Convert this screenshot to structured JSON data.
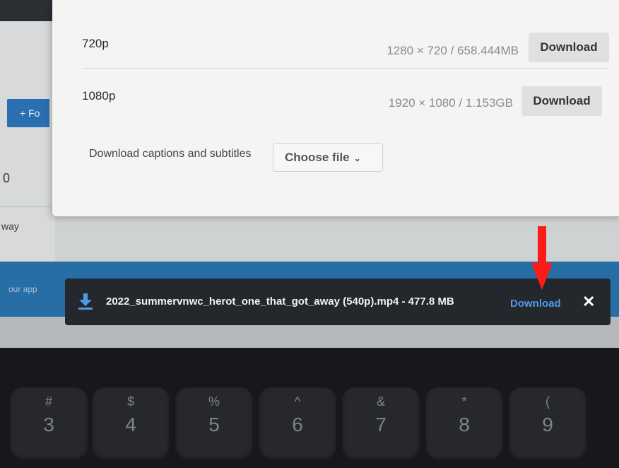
{
  "left_sidebar": {
    "follow_label": "+ Fo",
    "count": "0",
    "away_text": "way",
    "our_app": "our app"
  },
  "modal": {
    "rows": [
      {
        "label": "720p",
        "info": "1280 × 720 / 658.444MB",
        "button": "Download"
      },
      {
        "label": "1080p",
        "info": "1920 × 1080 / 1.153GB",
        "button": "Download"
      }
    ],
    "captions_label": "Download captions and subtitles",
    "choose_file": "Choose file",
    "chevron": "⌄"
  },
  "download_bar": {
    "filename": "2022_summervnwc_herot_one_that_got_away (540p).mp4 - 477.8 MB",
    "link": "Download",
    "close": "✕",
    "icon": "download-arrow-icon"
  },
  "annotation": {
    "arrow_color": "#ff1a1a"
  },
  "keyboard": {
    "keys": [
      {
        "sym": "#",
        "num": "3"
      },
      {
        "sym": "$",
        "num": "4"
      },
      {
        "sym": "%",
        "num": "5"
      },
      {
        "sym": "^",
        "num": "6"
      },
      {
        "sym": "&",
        "num": "7"
      },
      {
        "sym": "*",
        "num": "8"
      },
      {
        "sym": "(",
        "num": "9"
      }
    ]
  }
}
